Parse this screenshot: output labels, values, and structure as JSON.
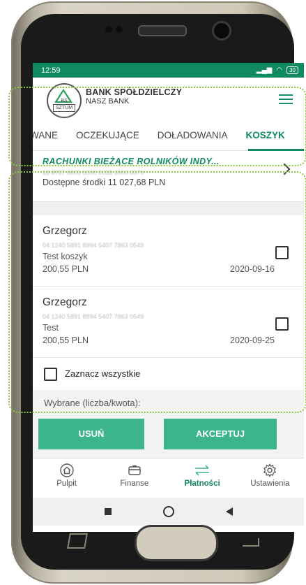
{
  "status_bar": {
    "time": "12:59",
    "battery": "30"
  },
  "bank": {
    "logo_line1": "BS",
    "logo_line2": "SZTUM",
    "name": "BANK SPÓŁDZIELCZY",
    "subtitle": "NASZ BANK"
  },
  "tabs": [
    {
      "label": "WANE",
      "active": false
    },
    {
      "label": "OCZEKUJĄCE",
      "active": false
    },
    {
      "label": "DOŁADOWANIA",
      "active": false
    },
    {
      "label": "KOSZYK",
      "active": true
    }
  ],
  "account": {
    "name": "RACHUNKI BIEŻĄCE ROLNIKÓW INDY...",
    "number": "18 8787 0000 0000 0058 3000 0070",
    "balance": "Dostępne środki 11 027,68 PLN"
  },
  "items": [
    {
      "name": "Grzegorz",
      "account": "04 1240 5891 8994 5407 7863 0549",
      "title": "Test koszyk",
      "amount": "200,55 PLN",
      "date": "2020-09-16",
      "checked": false
    },
    {
      "name": "Grzegorz",
      "account": "04 1240 5891 8994 5407 7863 0549",
      "title": "Test",
      "amount": "200,55 PLN",
      "date": "2020-09-25",
      "checked": false
    }
  ],
  "select_all_label": "Zaznacz wszystkie",
  "selected_label": "Wybrane (liczba/kwota):",
  "buttons": {
    "delete": "USUŃ",
    "accept": "AKCEPTUJ"
  },
  "bottom_nav": [
    {
      "label": "Pulpit",
      "icon": "home-icon",
      "active": false
    },
    {
      "label": "Finanse",
      "icon": "wallet-icon",
      "active": false
    },
    {
      "label": "Płatności",
      "icon": "transfer-arrows-icon",
      "active": true
    },
    {
      "label": "Ustawienia",
      "icon": "gear-icon",
      "active": false
    }
  ],
  "colors": {
    "accent": "#0f8a62",
    "button": "#3cb58c",
    "highlight": "#8cc63f"
  }
}
